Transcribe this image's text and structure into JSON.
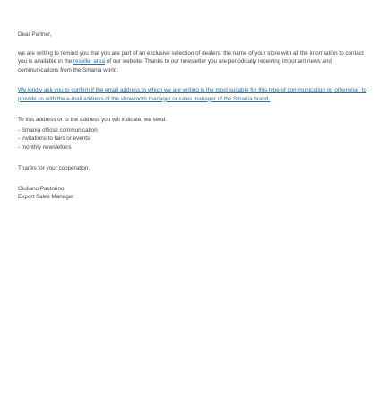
{
  "email": {
    "greeting": "Dear Partner,",
    "intro": {
      "before_link": "we are writing to remind you that you are part of an exclusive selection of dealers: the name of your store with all the information to contact you is available in the ",
      "link_text": "reseller area",
      "after_link": " of our website. Thanks to our newsletter you are periodically receiving important news and communications from the Smania world."
    },
    "request": "We kindly ask you to confirm if the email address to which we are writing is the most suitable for this type of communication or, otherwise, to provide us with the e-mail address of the showroom manager or sales manager of the Smania brand.",
    "send_lead": "To this address or to the address you will indicate, we send:",
    "items": [
      "- Smania official communication",
      "- invitations to fairs or events",
      "- monthly newsletters"
    ],
    "thanks": "Thanks for your cooperation,",
    "signature": {
      "name": "Giuliano Pastorino",
      "role": "Export Sales Manager"
    }
  },
  "colors": {
    "text": "#444444",
    "link": "#2f6f9a",
    "background": "#ffffff"
  }
}
